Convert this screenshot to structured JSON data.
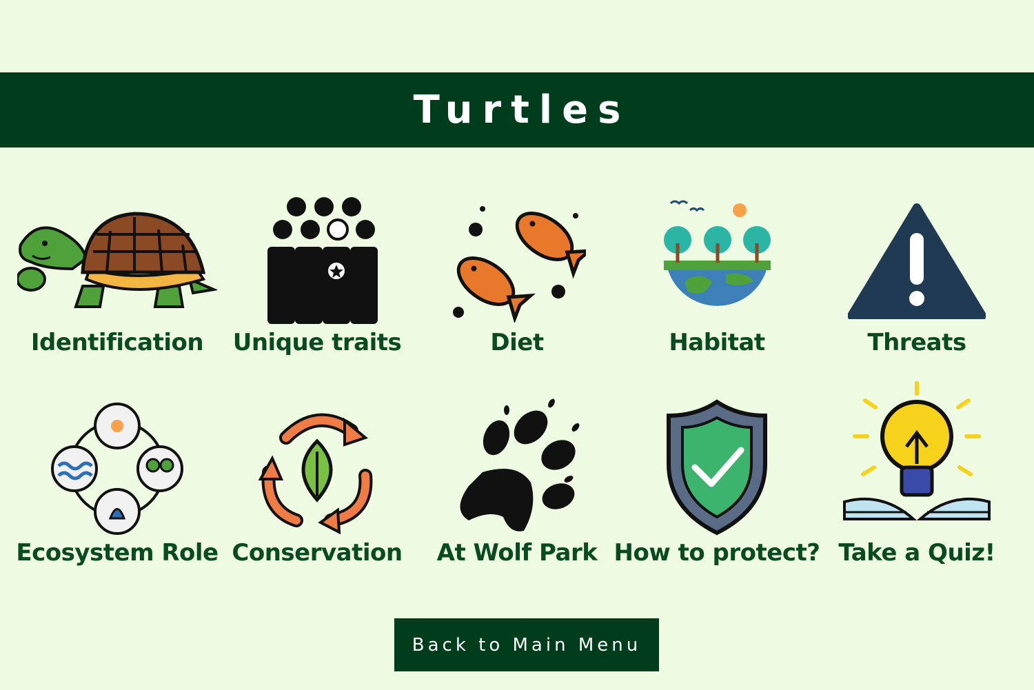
{
  "page": {
    "title": "Turtles",
    "background": "#eefbe2",
    "accent": "#003d1c",
    "label_color": "#0a4a22"
  },
  "tiles": [
    {
      "label": "Identification",
      "icon": "turtle-icon"
    },
    {
      "label": "Unique traits",
      "icon": "crowd-lightbulb-icon"
    },
    {
      "label": "Diet",
      "icon": "fish-icon"
    },
    {
      "label": "Habitat",
      "icon": "earth-trees-icon"
    },
    {
      "label": "Threats",
      "icon": "warning-icon"
    },
    {
      "label": "Ecosystem Role",
      "icon": "ecosystem-cycle-icon"
    },
    {
      "label": "Conservation",
      "icon": "recycle-leaf-icon"
    },
    {
      "label": "At Wolf Park",
      "icon": "paw-print-icon"
    },
    {
      "label": "How to protect?",
      "icon": "shield-check-icon"
    },
    {
      "label": "Take a Quiz!",
      "icon": "lightbulb-book-icon"
    }
  ],
  "back_button": {
    "label": "Back to Main Menu"
  }
}
